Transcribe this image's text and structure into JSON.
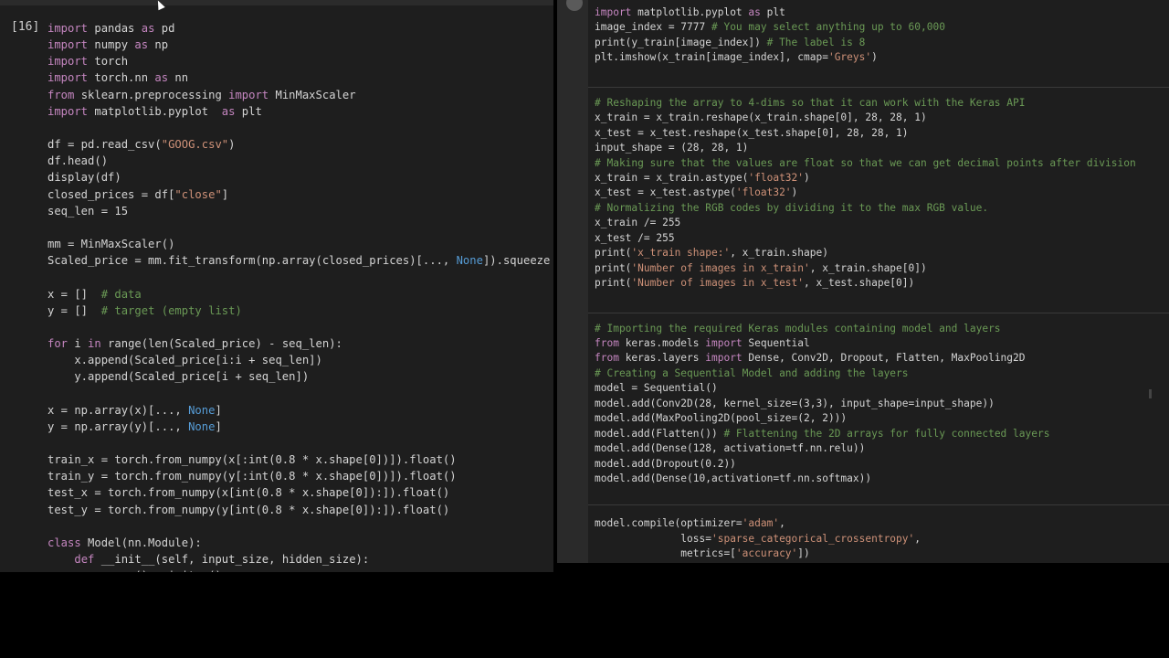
{
  "left_cell": {
    "execution_count": "[16]",
    "lines": [
      "import pandas as pd",
      "import numpy as np",
      "import torch",
      "import torch.nn as nn",
      "from sklearn.preprocessing import MinMaxScaler",
      "import matplotlib.pyplot  as plt",
      "",
      "df = pd.read_csv(\"GOOG.csv\")",
      "df.head()",
      "display(df)",
      "closed_prices = df[\"close\"]",
      "seq_len = 15",
      "",
      "mm = MinMaxScaler()",
      "Scaled_price = mm.fit_transform(np.array(closed_prices)[..., None]).squeeze",
      "",
      "x = []  # data",
      "y = []  # target (empty list)",
      "",
      "for i in range(len(Scaled_price) - seq_len):",
      "    x.append(Scaled_price[i:i + seq_len])",
      "    y.append(Scaled_price[i + seq_len])",
      "",
      "x = np.array(x)[..., None]",
      "y = np.array(y)[..., None]",
      "",
      "train_x = torch.from_numpy(x[:int(0.8 * x.shape[0])]).float()",
      "train_y = torch.from_numpy(y[:int(0.8 * x.shape[0])]).float()",
      "test_x = torch.from_numpy(x[int(0.8 * x.shape[0]):]).float()",
      "test_y = torch.from_numpy(y[int(0.8 * x.shape[0]):]).float()",
      "",
      "class Model(nn.Module):",
      "    def __init__(self, input_size, hidden_size):",
      "        super().__init__()"
    ]
  },
  "right_cell": {
    "lines": [
      "import matplotlib.pyplot as plt",
      "image_index = 7777 # You may select anything up to 60,000",
      "print(y_train[image_index]) # The label is 8",
      "plt.imshow(x_train[image_index], cmap='Greys')",
      "",
      "",
      "# Reshaping the array to 4-dims so that it can work with the Keras API",
      "x_train = x_train.reshape(x_train.shape[0], 28, 28, 1)",
      "x_test = x_test.reshape(x_test.shape[0], 28, 28, 1)",
      "input_shape = (28, 28, 1)",
      "# Making sure that the values are float so that we can get decimal points after division",
      "x_train = x_train.astype('float32')",
      "x_test = x_test.astype('float32')",
      "# Normalizing the RGB codes by dividing it to the max RGB value.",
      "x_train /= 255",
      "x_test /= 255",
      "print('x_train shape:', x_train.shape)",
      "print('Number of images in x_train', x_train.shape[0])",
      "print('Number of images in x_test', x_test.shape[0])",
      "",
      "",
      "# Importing the required Keras modules containing model and layers",
      "from keras.models import Sequential",
      "from keras.layers import Dense, Conv2D, Dropout, Flatten, MaxPooling2D",
      "# Creating a Sequential Model and adding the layers",
      "model = Sequential()",
      "model.add(Conv2D(28, kernel_size=(3,3), input_shape=input_shape))",
      "model.add(MaxPooling2D(pool_size=(2, 2)))",
      "model.add(Flatten()) # Flattening the 2D arrays for fully connected layers",
      "model.add(Dense(128, activation=tf.nn.relu))",
      "model.add(Dropout(0.2))",
      "model.add(Dense(10,activation=tf.nn.softmax))",
      "",
      "",
      "model.compile(optimizer='adam',",
      "              loss='sparse_categorical_crossentropy',",
      "              metrics=['accuracy'])"
    ]
  }
}
